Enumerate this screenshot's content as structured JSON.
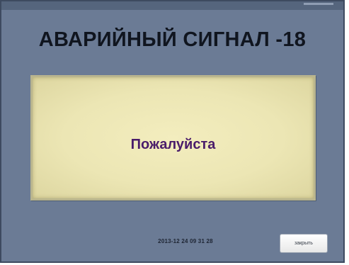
{
  "alarm": {
    "title": "АВАРИЙНЫЙ СИГНАЛ -18",
    "message": "Пожалуйста",
    "timestamp": "2013-12 24  09 31 28",
    "close_label": "закрыть"
  },
  "colors": {
    "window_background": "#6b7b95",
    "panel_background": "#ece6b4",
    "message_text": "#4a1c6a",
    "title_text": "#10151f"
  }
}
